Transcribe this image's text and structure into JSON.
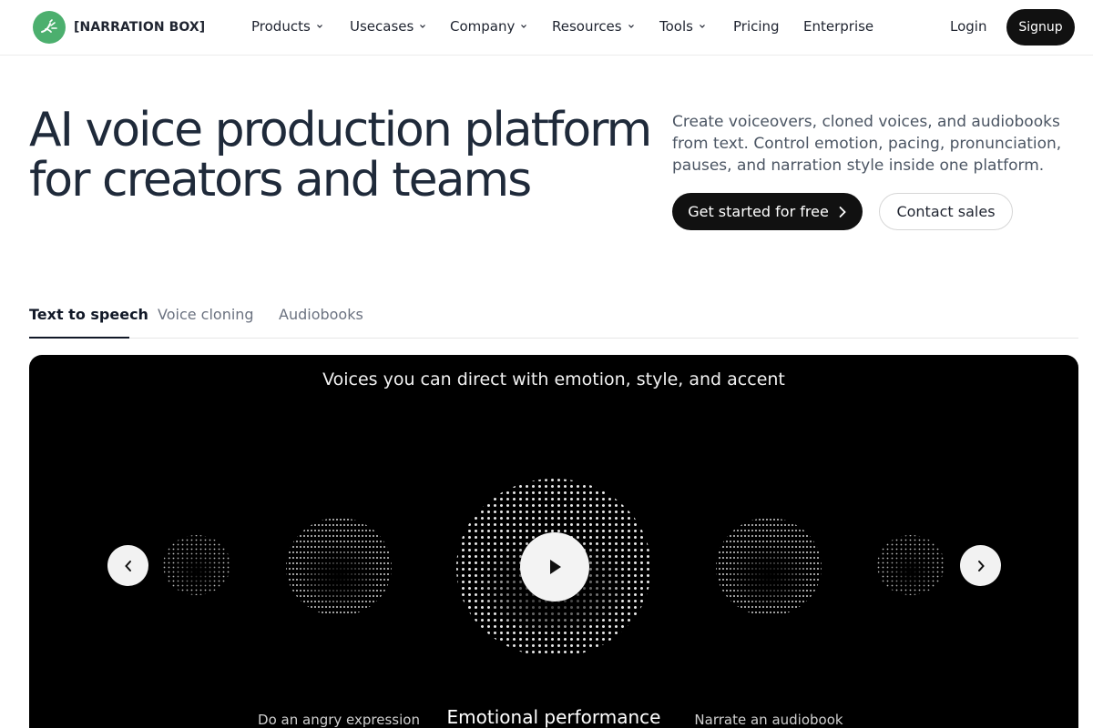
{
  "brand": {
    "name": "[NARRATION BOX]",
    "logo_color": "#4caf6e"
  },
  "nav": {
    "items": [
      {
        "label": "Products",
        "dropdown": true
      },
      {
        "label": "Usecases",
        "dropdown": true
      },
      {
        "label": "Company",
        "dropdown": true
      },
      {
        "label": "Resources",
        "dropdown": true
      },
      {
        "label": "Tools",
        "dropdown": true
      },
      {
        "label": "Pricing",
        "dropdown": false
      },
      {
        "label": "Enterprise",
        "dropdown": false
      }
    ],
    "login": "Login",
    "signup": "Signup"
  },
  "hero": {
    "title_line1": "AI voice production platform",
    "title_line2": "for creators and teams",
    "description": "Create voiceovers, cloned voices, and audiobooks from text. Control emotion, pacing, pronunciation, pauses, and narration style inside one platform.",
    "primary_cta": "Get started for free",
    "secondary_cta": "Contact sales"
  },
  "tabs": [
    {
      "label": "Text to speech",
      "active": true
    },
    {
      "label": "Voice cloning",
      "active": false
    },
    {
      "label": "Audiobooks",
      "active": false
    }
  ],
  "stage": {
    "title": "Voices you can direct with emotion, style, and accent",
    "captions": {
      "left": "Do an angry expression",
      "center": "Emotional performance",
      "right": "Narrate an audiobook"
    }
  },
  "colors": {
    "primary": "#111111",
    "stage_bg": "#000000",
    "text": "#1f2430"
  },
  "icons": [
    "leaf-logo-icon",
    "chevron-down-icon",
    "chevron-right-icon",
    "chevron-left-icon",
    "play-icon"
  ]
}
